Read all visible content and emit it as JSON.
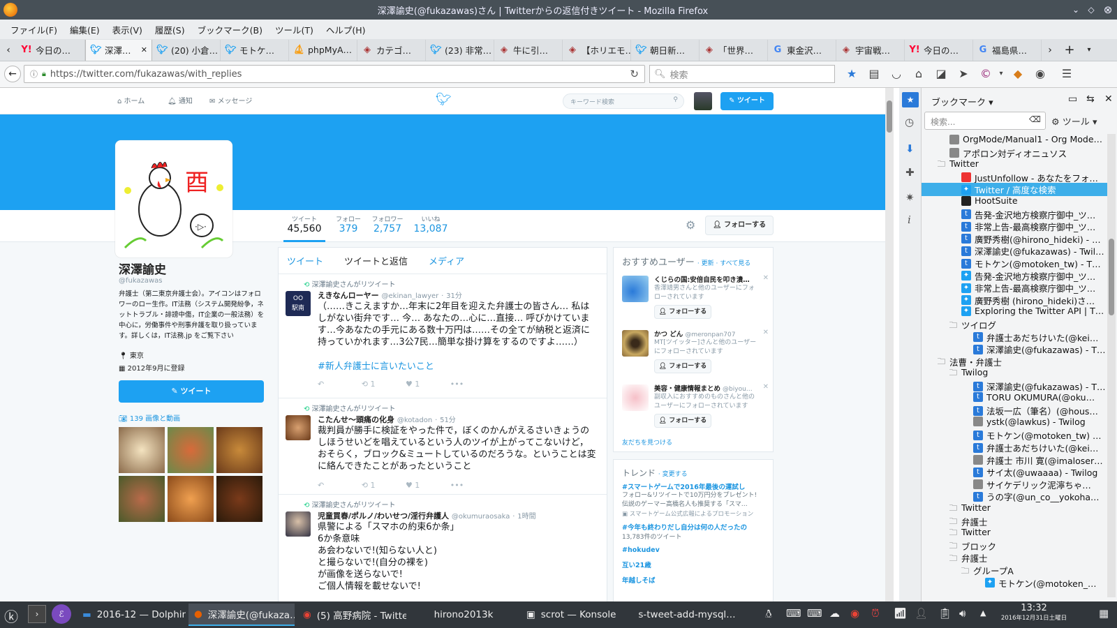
{
  "window": {
    "title": "深澤諭史(@fukazawas)さん | Twitterからの返信付きツイート - Mozilla Firefox"
  },
  "menu": [
    "ファイル(F)",
    "編集(E)",
    "表示(V)",
    "履歴(S)",
    "ブックマーク(B)",
    "ツール(T)",
    "ヘルプ(H)"
  ],
  "tabs": [
    {
      "label": "今日の…",
      "icon": "yahoo-icon"
    },
    {
      "label": "深澤…",
      "icon": "twitter-icon",
      "active": true
    },
    {
      "label": "(20) 小倉…",
      "icon": "twitter-icon"
    },
    {
      "label": "モトケ…",
      "icon": "twitter-icon"
    },
    {
      "label": "phpMyA…",
      "icon": "phpmyadmin-icon"
    },
    {
      "label": "カテゴ…",
      "icon": "site-icon"
    },
    {
      "label": "(23) 非常…",
      "icon": "twitter-icon"
    },
    {
      "label": "牛に引…",
      "icon": "site-icon"
    },
    {
      "label": "【ホリエモ…",
      "icon": "site-icon"
    },
    {
      "label": "朝日新…",
      "icon": "twitter-icon"
    },
    {
      "label": "「世界…",
      "icon": "site-icon"
    },
    {
      "label": "東金沢…",
      "icon": "google-icon"
    },
    {
      "label": "宇宙戦…",
      "icon": "site-icon"
    },
    {
      "label": "今日の…",
      "icon": "yahoo-icon"
    },
    {
      "label": "福島県…",
      "icon": "google-icon"
    }
  ],
  "nav": {
    "url": "https://twitter.com/fukazawas/with_replies",
    "search_placeholder": "検索"
  },
  "twitter": {
    "top": {
      "home": "ホーム",
      "notifications": "通知",
      "messages": "メッセージ",
      "search_placeholder": "キーワード検索",
      "tweet": "ツイート"
    },
    "stats": [
      {
        "label": "ツイート",
        "value": "45,560"
      },
      {
        "label": "フォロー",
        "value": "379"
      },
      {
        "label": "フォロワー",
        "value": "2,757"
      },
      {
        "label": "いいね",
        "value": "13,087"
      }
    ],
    "follow_button": "フォローする",
    "profile": {
      "name": "深澤諭史",
      "handle": "@fukazawas",
      "bio": "弁護士（第二東京弁護士会）。アイコンはフォロワーのロー生作。IT法務（システム開発紛争，ネットトラブル・誹謗中傷，IT企業の一般法務）を中心に，労働事件や刑事弁護を取り扱っています。詳しくは，IT法務.jp をご覧下さい",
      "location": "東京",
      "joined": "2012年9月に登録",
      "tweet_button": "ツイート",
      "media": "139 画像と動画"
    },
    "tabs": [
      "ツイート",
      "ツイートと返信",
      "メディア"
    ],
    "tweets": [
      {
        "retweet": "深澤諭史さんがリツイート",
        "name": "えきなんローヤー",
        "handle": "@ekinan_lawyer",
        "time": "31分",
        "text": "（……きこえますか…年末に2年目を迎えた弁護士の皆さん… 私はしがない街弁です… 今… あなたの…心に…直接… 呼びかけています…今あなたの手元にある数十万円は……その全てが納税と返済に持っていかれます…3公7民…簡単な掛け算をするのですよ……）",
        "hashtag": "#新人弁護士に言いたいこと",
        "rt": "1",
        "like": "1"
      },
      {
        "retweet": "深澤諭史さんがリツイート",
        "name": "こたんせ～頭痛の化身",
        "handle": "@kotadon",
        "time": "51分",
        "text": "裁判員が勝手に検証をやった件で，ぼくのかんがえるさいきょうのしほうせいどを唱えているという人のツイが上がってこないけど，おそらく，ブロック&ミュートしているのだろうな。ということは変に絡んできたことがあったということ",
        "hashtag": "",
        "rt": "1",
        "like": "1"
      },
      {
        "retweet": "深澤諭史さんがリツイート",
        "name": "児童買春/ポルノ/わいせつ/淫行弁護人",
        "handle": "@okumuraosaka",
        "time": "1時間",
        "lines": [
          "県警による「スマホの約束6か条」",
          "6か条意味",
          "あ会わないで!(知らない人と)",
          "と撮らないで!(自分の裸を)",
          "が画像を送らないで!",
          "ご個人情報を載せないで!"
        ]
      }
    ],
    "suggest": {
      "title": "おすすめユーザー",
      "refresh": "更新",
      "viewall": "すべて見る",
      "users": [
        {
          "name": "くじらの国:安倍自民を叩き潰…",
          "sub": "香澤靖男さんと他のユーザーにフォローされています",
          "btn": "フォローする"
        },
        {
          "name": "かつ どん",
          "handle": "@meronpan707",
          "sub": "MT[ツイッター]さんと他のユーザーにフォローされています",
          "btn": "フォローする"
        },
        {
          "name": "美容・健康情報まとめ",
          "handle": "@biyou…",
          "sub": "副収入におすすめのものさんと他のユーザーにフォローされています",
          "btn": "フォローする"
        }
      ],
      "find": "友だちを見つける"
    },
    "trends": {
      "title": "トレンド",
      "change": "変更する",
      "items": [
        {
          "tag": "#スマートゲームで2016年最後の運試し",
          "desc": "フォロー&リツイートで10万円分をプレゼント! 伝説のゲーマー高橋名人も推奨する「スマ…",
          "promo": "スマートゲーム公式広報によるプロモーション"
        },
        {
          "tag": "#今年も終わりだし自分は何の人だったの",
          "desc": "13,783件のツイート"
        },
        {
          "tag": "#hokudev"
        },
        {
          "tag": "互い21歳"
        },
        {
          "tag": "年越しそば"
        }
      ]
    }
  },
  "bookmarks": {
    "title": "ブックマーク",
    "search_placeholder": "検索...",
    "tools": "ツール",
    "items": [
      {
        "label": "OrgMode/Manual1 - Org Mode…",
        "indent": 2,
        "type": "link",
        "icon": "site"
      },
      {
        "label": "アポロン対ディオニュソス",
        "indent": 2,
        "type": "link",
        "icon": "site"
      },
      {
        "label": "Twitter",
        "indent": 1,
        "type": "folder",
        "open": true
      },
      {
        "label": "JustUnfollow - あなたをフォ…",
        "indent": 3,
        "type": "link",
        "icon": "red"
      },
      {
        "label": "Twitter / 高度な検索",
        "indent": 3,
        "type": "link",
        "icon": "twitter",
        "selected": true
      },
      {
        "label": "HootSuite",
        "indent": 3,
        "type": "link",
        "icon": "dark"
      },
      {
        "label": "告発-金沢地方検察庁御中_ツ…",
        "indent": 3,
        "type": "link",
        "icon": "blue"
      },
      {
        "label": "非常上告-最高検察庁御中_ツ…",
        "indent": 3,
        "type": "link",
        "icon": "blue"
      },
      {
        "label": "廣野秀樹(@hirono_hideki) - …",
        "indent": 3,
        "type": "link",
        "icon": "blue"
      },
      {
        "label": "深澤諭史(@fukazawas) - Twil…",
        "indent": 3,
        "type": "link",
        "icon": "blue"
      },
      {
        "label": "モトケン(@motoken_tw) - T…",
        "indent": 3,
        "type": "link",
        "icon": "blue"
      },
      {
        "label": "告発-金沢地方検察庁御中_ツ…",
        "indent": 3,
        "type": "link",
        "icon": "twitter"
      },
      {
        "label": "非常上告-最高検察庁御中_ツ…",
        "indent": 3,
        "type": "link",
        "icon": "twitter"
      },
      {
        "label": "廣野秀樹 (hirono_hideki)さ…",
        "indent": 3,
        "type": "link",
        "icon": "twitter"
      },
      {
        "label": "Exploring the Twitter API | T…",
        "indent": 3,
        "type": "link",
        "icon": "twitter"
      },
      {
        "label": "ツイログ",
        "indent": 2,
        "type": "folder"
      },
      {
        "label": "弁護士あだちけいた(@kei…",
        "indent": 4,
        "type": "link",
        "icon": "blue"
      },
      {
        "label": "深澤諭史(@fukazawas) - T…",
        "indent": 4,
        "type": "link",
        "icon": "blue"
      },
      {
        "label": "法曹・弁護士",
        "indent": 1,
        "type": "folder"
      },
      {
        "label": "Twilog",
        "indent": 2,
        "type": "folder",
        "open": true
      },
      {
        "label": "深澤諭史(@fukazawas) - T…",
        "indent": 4,
        "type": "link",
        "icon": "blue"
      },
      {
        "label": "TORU OKUMURA(@oku…",
        "indent": 4,
        "type": "link",
        "icon": "blue"
      },
      {
        "label": "法坂一広（筆名）(@hous…",
        "indent": 4,
        "type": "link",
        "icon": "blue"
      },
      {
        "label": "ystk(@lawkus) - Twilog",
        "indent": 4,
        "type": "link",
        "icon": "site"
      },
      {
        "label": "モトケン(@motoken_tw) …",
        "indent": 4,
        "type": "link",
        "icon": "blue"
      },
      {
        "label": "弁護士あだちけいた(@kei…",
        "indent": 4,
        "type": "link",
        "icon": "blue"
      },
      {
        "label": "弁護士 市川 寛(@imaloser…",
        "indent": 4,
        "type": "link",
        "icon": "site"
      },
      {
        "label": "サイ太(@uwaaaa) - Twilog",
        "indent": 4,
        "type": "link",
        "icon": "blue"
      },
      {
        "label": "サイケデリック泥濘ちゃ…",
        "indent": 4,
        "type": "link",
        "icon": "site"
      },
      {
        "label": "うの字(@un_co__yokoha…",
        "indent": 4,
        "type": "link",
        "icon": "blue"
      },
      {
        "label": "Twitter",
        "indent": 2,
        "type": "folder"
      },
      {
        "label": "弁護士",
        "indent": 2,
        "type": "folder"
      },
      {
        "label": "Twitter",
        "indent": 2,
        "type": "folder"
      },
      {
        "label": "ブロック",
        "indent": 2,
        "type": "folder"
      },
      {
        "label": "弁護士",
        "indent": 2,
        "type": "folder"
      },
      {
        "label": "グループA",
        "indent": 3,
        "type": "folder"
      },
      {
        "label": "モトケン(@motoken_…",
        "indent": 5,
        "type": "link",
        "icon": "twitter"
      }
    ]
  },
  "taskbar": {
    "items": [
      "2016-12 — Dolphin",
      "深澤諭史(@fukaza…",
      "(5) 高野病院 - Twitte…",
      "hirono2013k",
      "scrot — Konsole",
      "s-tweet-add-mysql…"
    ],
    "time": "13:32",
    "date": "2016年12月31日土曜日"
  }
}
